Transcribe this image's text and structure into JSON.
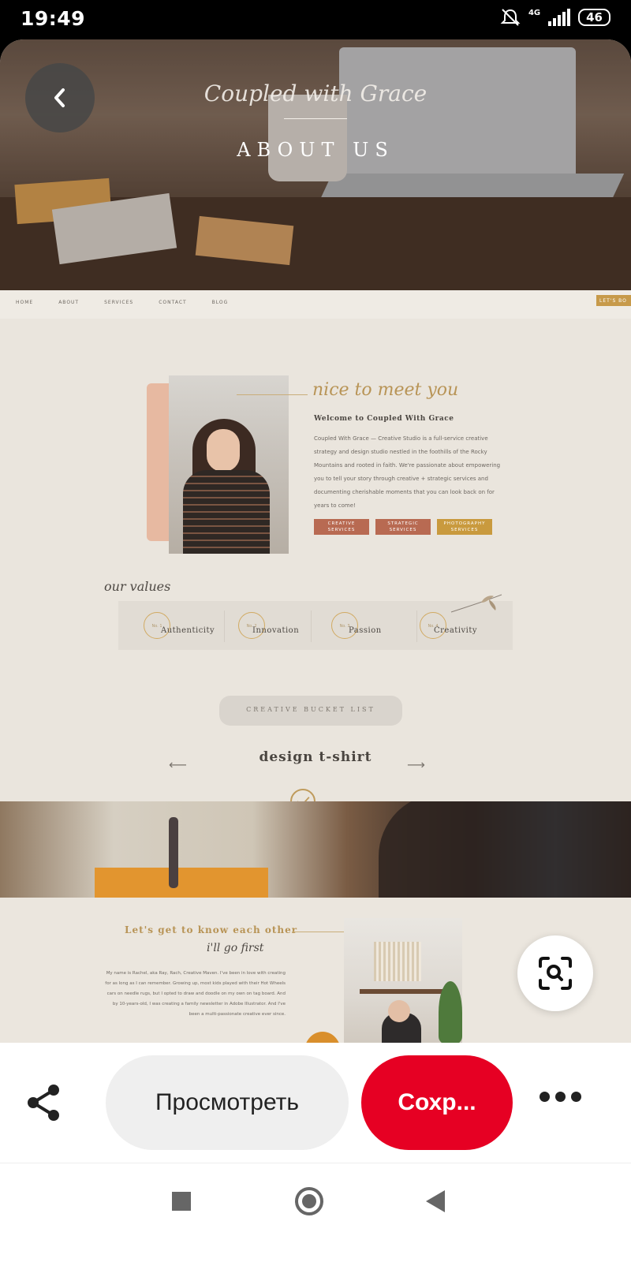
{
  "status_bar": {
    "time": "19:49",
    "network": "4G",
    "battery": "46",
    "icons": [
      "mute-icon",
      "signal-icon",
      "battery-icon"
    ]
  },
  "pin": {
    "hero": {
      "logo_script": "Coupled with Grace",
      "title": "ABOUT US"
    },
    "site_nav": {
      "links": [
        "HOME",
        "ABOUT",
        "SERVICES",
        "CONTACT",
        "BLOG"
      ],
      "cta": "LET'S BO"
    },
    "welcome": {
      "script_heading": "nice to meet you",
      "title": "Welcome to Coupled With Grace",
      "body": "Coupled With Grace — Creative Studio is a full-service creative strategy and design studio nestled in the foothills of the Rocky Mountains and rooted in faith. We're passionate about empowering you to tell your story through creative + strategic services and documenting cherishable moments that you can look back on for years to come!",
      "services": [
        "CREATIVE SERVICES",
        "STRATEGIC SERVICES",
        "PHOTOGRAPHY SERVICES"
      ]
    },
    "values": {
      "script_heading": "our values",
      "items": [
        {
          "num": "No. 1",
          "name": "Authenticity"
        },
        {
          "num": "No. 2",
          "name": "Innovation"
        },
        {
          "num": "No. 3",
          "name": "Passion"
        },
        {
          "num": "No. 4",
          "name": "Creativity"
        }
      ]
    },
    "bucket": {
      "label": "CREATIVE BUCKET LIST",
      "item": "design t-shirt"
    },
    "know": {
      "title": "Let's get to know each other",
      "script": "i'll go first",
      "body": "My name is Rachel, aka Ray, Rach, Creative Maven. I've been in love with creating for as long as I can remember. Growing up, most kids played with their Hot Wheels cars on needle rugs, but I opted to draw and doodle on my own on tag board. And by 10-years-old, I was creating a family newsletter in Adobe Illustrator. And I've been a multi-passionate creative ever since."
    }
  },
  "actions": {
    "view_label": "Просмотреть",
    "save_label": "Сохр..."
  },
  "colors": {
    "save_red": "#e60023",
    "accent_gold": "#b89456",
    "terracotta": "#b86a52"
  }
}
